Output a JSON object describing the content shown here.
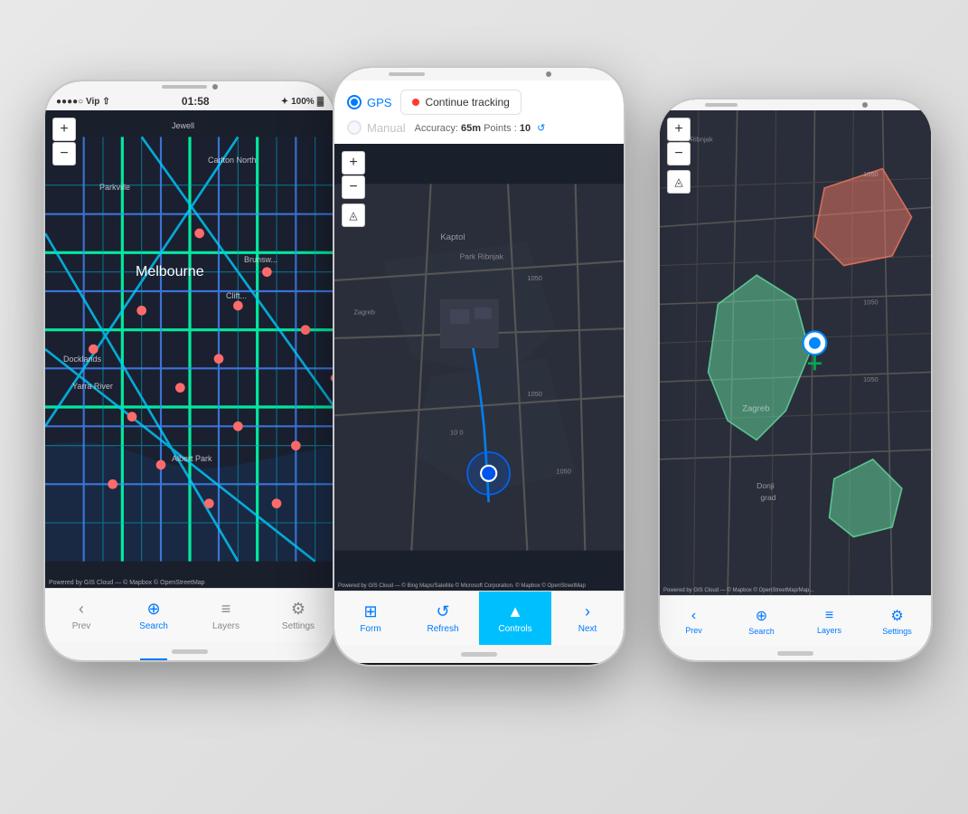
{
  "scene": {
    "background": "#e8e8e8"
  },
  "phone_left": {
    "status": {
      "signal": "●●●●○ Vip",
      "wifi": "▲",
      "time": "01:58",
      "bluetooth": "✦",
      "battery": "100%"
    },
    "map": {
      "city": "Melbourne",
      "labels": [
        "Jewell",
        "Carlton North",
        "Parkville",
        "Docklands",
        "Yarra River",
        "Albert Park",
        "Clifton Hill",
        "Brunswick"
      ],
      "powered_by": "Powered by GIS Cloud — © Mapbox © OpenStreetMap"
    },
    "zoom_plus": "+",
    "zoom_minus": "−",
    "nav": [
      {
        "icon": "‹",
        "label": "Prev",
        "active": false
      },
      {
        "icon": "⊕",
        "label": "Search",
        "active": true
      },
      {
        "icon": "≡",
        "label": "Layers",
        "active": false
      },
      {
        "icon": "⚙",
        "label": "Settings",
        "active": false
      }
    ]
  },
  "phone_center": {
    "gps_label": "GPS",
    "manual_label": "Manual",
    "continue_tracking": "Continue tracking",
    "accuracy_label": "Accuracy:",
    "accuracy_value": "65m",
    "points_label": "Points :",
    "points_value": "10",
    "map": {
      "area": "Kaptol",
      "powered_by": "Powered by GIS Cloud — © Bing Maps/Satellite © Microsoft Corporation. © Mapbox © OpenStreetMap"
    },
    "zoom_plus": "+",
    "zoom_minus": "−",
    "toolbar": [
      {
        "icon": "⊞",
        "label": "Form",
        "active": false
      },
      {
        "icon": "↺",
        "label": "Refresh",
        "active": false
      },
      {
        "icon": "▲",
        "label": "Controls",
        "active": true
      },
      {
        "icon": "›",
        "label": "Next",
        "active": false
      }
    ]
  },
  "phone_right": {
    "map": {
      "area": "Donji grad",
      "powered_by": "Powered by GIS Cloud — © Mapbox © OpenStreetMap/Map..."
    },
    "zoom_plus": "+",
    "zoom_minus": "−",
    "nav": [
      {
        "icon": "‹",
        "label": "Prev",
        "active": false
      },
      {
        "icon": "⊕",
        "label": "Search",
        "active": false
      },
      {
        "icon": "≡",
        "label": "Layers",
        "active": false
      },
      {
        "icon": "⚙",
        "label": "Settings",
        "active": false
      }
    ]
  }
}
